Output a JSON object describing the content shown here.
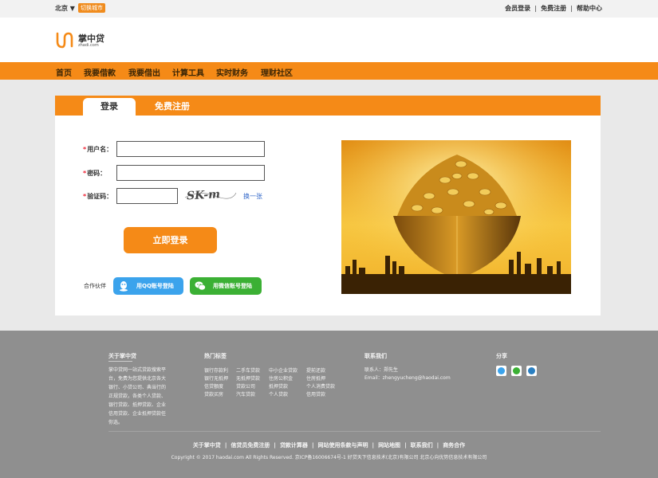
{
  "topbar": {
    "city": "北京 ▼",
    "switch_city": "切换城市",
    "links": [
      "会员登录",
      "免费注册",
      "帮助中心"
    ]
  },
  "header": {
    "logo_name": "掌中贷",
    "logo_domain": "zhadi.com"
  },
  "nav": {
    "items": [
      "首页",
      "我要借款",
      "我要借出",
      "计算工具",
      "实时财务",
      "理财社区"
    ]
  },
  "login_panel": {
    "tab_login": "登录",
    "tab_register": "免费注册",
    "required_mark": "*",
    "username_label": "用户名：",
    "password_label": "密码：",
    "captcha_label": "验证码：",
    "captcha_text": "SK-m",
    "refresh_captcha": "换一张",
    "login_button": "立即登录",
    "partner_label": "合作伙伴",
    "qq_login": "用QQ账号登陆",
    "wechat_login": "用微信账号登陆"
  },
  "footer": {
    "about_title": "关于掌中贷",
    "about_text": [
      "掌中贷网一站式贷款搜索平",
      "台，免费为您提供北京各大",
      "银行、小贷公司、典当行的",
      "正规贷款，各类个人贷款、",
      "银行贷款、抵押贷款、企业",
      "信用贷款、企业抵押贷款任",
      "你选。"
    ],
    "tags_title": "热门标签",
    "tags": [
      [
        "银行存款利",
        "二手车贷款",
        "中小企业贷款",
        "提前还款"
      ],
      [
        "银行无抵押",
        "无抵押贷款",
        "住房公积金",
        "住房抵押"
      ],
      [
        "信贷额度",
        "贷款公司",
        "抵押贷款",
        "个人消费贷款"
      ],
      [
        "贷款买房",
        "汽车贷款",
        "个人贷款",
        "信用贷款"
      ]
    ],
    "contact_title": "联系我们",
    "contact_person": "联系人：郑先生",
    "contact_email": "Email：zhengyucheng@haodai.com",
    "share_title": "分享",
    "bottom_links": [
      "关于掌中贷",
      "信贷员免费注册",
      "贷款计算器",
      "网站使用条款与声明",
      "网站地图",
      "联系我们",
      "商务合作"
    ],
    "bottom_sep": "|",
    "copyright": "Copyright © 2017 haodai.com All Rights Reserved. 京ICP备16006674号-1 好贷天下信息技术(北京)有限公司 北京心向优势信息技术有限公司"
  },
  "colors": {
    "brand_orange": "#f58a17",
    "qq_blue": "#3ba3ec",
    "wechat_green": "#3bb034"
  },
  "icons": [
    "logo-mark-icon",
    "qq-icon",
    "wechat-icon",
    "share-qzone-icon",
    "share-wechat-icon",
    "share-tencent-weibo-icon"
  ]
}
